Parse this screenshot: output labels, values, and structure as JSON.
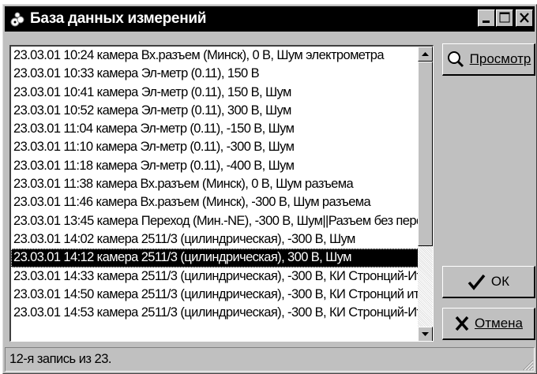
{
  "window": {
    "title": "База данных измерений",
    "icon": "app-icon"
  },
  "list": {
    "items": [
      "23.03.01 10:24 камера Вх.разъем (Минск), 0 В, Шум электрометра",
      "23.03.01 10:33 камера Эл-метр (0.11), 150 В",
      "23.03.01 10:41 камера Эл-метр (0.11), 150 В, Шум",
      "23.03.01 10:52 камера Эл-метр (0.11), 300 В, Шум",
      "23.03.01 11:04 камера Эл-метр (0.11), -150 В, Шум",
      "23.03.01 11:10 камера Эл-метр (0.11), -300 В, Шум",
      "23.03.01 11:18 камера Эл-метр (0.11), -400 В, Шум",
      "23.03.01 11:38 камера Вх.разъем (Минск), 0 В, Шум разъема",
      "23.03.01 11:46 камера Вх.разъем (Минск), -300 В, Шум разъема",
      "23.03.01 13:45 камера Переход (Мин.-NE), -300 В, Шум||Разъем без переход",
      "23.03.01 14:02 камера 2511/3 (цилиндрическая), -300 В, Шум",
      "23.03.01 14:12 камера 2511/3 (цилиндрическая), 300 В, Шум",
      "23.03.01 14:33 камера 2511/3 (цилиндрическая), -300 В, КИ Стронций-Иттри",
      "23.03.01 14:50 камера 2511/3 (цилиндрическая), -300 В, КИ Стронций иттри",
      "23.03.01 14:53 камера 2511/3 (цилиндрическая), -300 В, КИ Стронций-Иттри"
    ],
    "selected_index": 11
  },
  "buttons": {
    "view_label": "Просмотр",
    "ok_label": "ОК",
    "cancel_label": "Отмена"
  },
  "status": {
    "text": "12-я запись из 23."
  },
  "colors": {
    "titlebar": "#000000",
    "face": "#c0c0c0",
    "selection": "#000000"
  }
}
